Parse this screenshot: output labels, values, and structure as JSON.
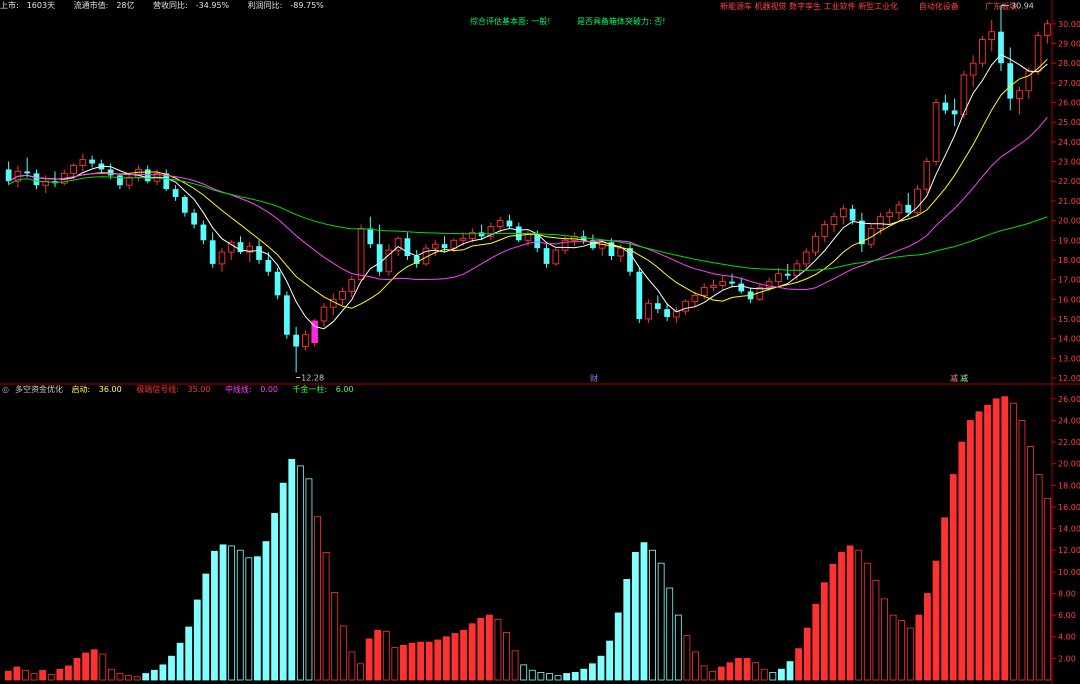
{
  "header": {
    "listing_days_label": "上市:",
    "listing_days": "1603天",
    "float_cap_label": "流通市值:",
    "float_cap": "28亿",
    "revenue_yoy_label": "营收同比:",
    "revenue_yoy": "-34.95%",
    "profit_yoy_label": "利润同比:",
    "profit_yoy": "-89.75%"
  },
  "signals": {
    "fundamental": "综合评估基本面: 一般!",
    "breakout": "是否具备箱体突破力: 否!"
  },
  "concept_tags": [
    "新能源车",
    "机器视觉",
    "数字孪生",
    "工业软件",
    "新型工业化",
    "自动化设备",
    "广东板块"
  ],
  "main_chart": {
    "y_ticks": [
      "30.00",
      "29.00",
      "28.00",
      "27.00",
      "26.00",
      "25.00",
      "24.00",
      "23.00",
      "22.00",
      "21.00",
      "20.00",
      "19.00",
      "18.00",
      "17.00",
      "16.00",
      "15.00",
      "14.00",
      "13.00",
      "12.00"
    ],
    "high_label": "30.94",
    "low_label": "12.28",
    "bottom_markers": [
      "财",
      "减",
      "减"
    ]
  },
  "sub_chart": {
    "indicator_name": "多空资金优化",
    "qidong_label": "启动:",
    "qidong_value": "36.00",
    "jiduan_label": "极端信号线:",
    "jiduan_value": "35.00",
    "zhongxian_label": "中线线:",
    "zhongxian_value": "0.00",
    "qianjin_label": "千金一柱:",
    "qianjin_value": "6.00",
    "y_ticks": [
      "26.00",
      "24.00",
      "22.00",
      "20.00",
      "18.00",
      "16.00",
      "14.00",
      "12.00",
      "10.00",
      "8.00",
      "6.00",
      "4.00",
      "2.00"
    ]
  },
  "colors": {
    "up": "#ff3232",
    "down": "#54fcfc",
    "ma5": "#ffffff",
    "ma10": "#ffff00",
    "ma20": "#ff40ff",
    "ma60": "#00dd00",
    "sell": "#ff4040",
    "buy": "#80ffff"
  },
  "chart_data": [
    {
      "type": "candlestick",
      "ylim": [
        12,
        30.5
      ],
      "y_ticks": [
        30,
        29,
        28,
        27,
        26,
        25,
        24,
        23,
        22,
        21,
        20,
        19,
        18,
        17,
        16,
        15,
        14,
        13,
        12
      ],
      "ohlc": [
        [
          22.6,
          23.0,
          21.8,
          22.0
        ],
        [
          22.0,
          22.8,
          21.7,
          22.5
        ],
        [
          22.5,
          23.2,
          22.2,
          22.4
        ],
        [
          22.4,
          22.6,
          21.6,
          21.8
        ],
        [
          21.8,
          22.3,
          21.4,
          22.0
        ],
        [
          22.0,
          22.5,
          21.7,
          21.9
        ],
        [
          21.9,
          22.6,
          21.8,
          22.4
        ],
        [
          22.4,
          22.9,
          22.1,
          22.8
        ],
        [
          22.8,
          23.4,
          22.5,
          23.1
        ],
        [
          23.1,
          23.3,
          22.7,
          22.9
        ],
        [
          22.9,
          23.1,
          22.4,
          22.6
        ],
        [
          22.6,
          22.9,
          22.1,
          22.3
        ],
        [
          22.3,
          22.4,
          21.6,
          21.8
        ],
        [
          21.8,
          22.4,
          21.6,
          22.2
        ],
        [
          22.2,
          22.8,
          22.0,
          22.6
        ],
        [
          22.6,
          22.8,
          21.9,
          22.0
        ],
        [
          22.0,
          22.6,
          21.8,
          22.4
        ],
        [
          22.4,
          22.6,
          21.5,
          21.6
        ],
        [
          21.6,
          21.8,
          21.0,
          21.2
        ],
        [
          21.2,
          21.3,
          20.2,
          20.4
        ],
        [
          20.4,
          20.6,
          19.6,
          19.8
        ],
        [
          19.8,
          20.0,
          18.8,
          19.0
        ],
        [
          19.0,
          19.4,
          17.6,
          17.8
        ],
        [
          17.8,
          18.6,
          17.4,
          18.4
        ],
        [
          18.4,
          19.0,
          18.0,
          18.9
        ],
        [
          18.9,
          19.2,
          18.3,
          18.4
        ],
        [
          18.4,
          18.9,
          17.9,
          18.7
        ],
        [
          18.7,
          19.0,
          17.8,
          18.0
        ],
        [
          18.0,
          18.4,
          17.2,
          17.4
        ],
        [
          17.4,
          17.6,
          16.0,
          16.2
        ],
        [
          16.2,
          16.4,
          14.0,
          14.2
        ],
        [
          14.2,
          14.6,
          12.28,
          13.6
        ],
        [
          13.6,
          14.4,
          13.4,
          14.2
        ],
        [
          13.8,
          15.0,
          13.6,
          14.9
        ],
        [
          14.9,
          15.8,
          14.6,
          15.6
        ],
        [
          15.6,
          16.3,
          15.2,
          16.0
        ],
        [
          16.0,
          16.6,
          15.7,
          16.4
        ],
        [
          16.4,
          17.2,
          16.1,
          17.0
        ],
        [
          17.0,
          19.8,
          16.9,
          19.6
        ],
        [
          19.6,
          20.2,
          18.6,
          18.8
        ],
        [
          18.8,
          19.8,
          17.2,
          17.4
        ],
        [
          17.4,
          18.8,
          17.2,
          18.5
        ],
        [
          18.5,
          19.2,
          18.2,
          19.1
        ],
        [
          19.1,
          19.4,
          18.0,
          18.2
        ],
        [
          18.2,
          18.5,
          17.6,
          17.8
        ],
        [
          17.8,
          18.8,
          17.7,
          18.6
        ],
        [
          18.6,
          19.0,
          18.2,
          18.8
        ],
        [
          18.8,
          19.2,
          18.4,
          18.6
        ],
        [
          18.6,
          19.1,
          18.4,
          19.0
        ],
        [
          19.0,
          19.4,
          18.7,
          19.1
        ],
        [
          19.1,
          19.6,
          18.9,
          19.4
        ],
        [
          19.4,
          19.8,
          19.0,
          19.2
        ],
        [
          19.2,
          19.9,
          19.0,
          19.7
        ],
        [
          19.7,
          20.2,
          19.4,
          20.0
        ],
        [
          20.0,
          20.3,
          19.6,
          19.7
        ],
        [
          19.7,
          19.9,
          18.9,
          19.0
        ],
        [
          19.0,
          19.5,
          18.7,
          19.3
        ],
        [
          19.3,
          19.5,
          18.4,
          18.6
        ],
        [
          18.6,
          18.8,
          17.6,
          17.8
        ],
        [
          17.8,
          18.6,
          17.7,
          18.5
        ],
        [
          18.5,
          19.2,
          18.3,
          19.0
        ],
        [
          19.0,
          19.4,
          18.7,
          19.2
        ],
        [
          19.2,
          19.5,
          18.8,
          19.0
        ],
        [
          19.0,
          19.3,
          18.5,
          18.6
        ],
        [
          18.6,
          19.0,
          18.2,
          18.9
        ],
        [
          18.9,
          19.1,
          18.0,
          18.2
        ],
        [
          18.2,
          18.8,
          17.9,
          18.6
        ],
        [
          18.6,
          18.9,
          17.2,
          17.4
        ],
        [
          17.4,
          17.6,
          14.8,
          15.0
        ],
        [
          15.0,
          16.0,
          14.8,
          15.8
        ],
        [
          15.8,
          16.2,
          15.3,
          15.5
        ],
        [
          15.5,
          15.8,
          14.9,
          15.1
        ],
        [
          15.1,
          15.6,
          14.8,
          15.4
        ],
        [
          15.4,
          16.0,
          15.2,
          15.9
        ],
        [
          15.9,
          16.4,
          15.6,
          16.2
        ],
        [
          16.2,
          16.8,
          16.0,
          16.6
        ],
        [
          16.6,
          17.0,
          16.4,
          16.7
        ],
        [
          16.7,
          17.2,
          16.5,
          16.9
        ],
        [
          16.9,
          17.3,
          16.6,
          16.8
        ],
        [
          16.8,
          17.1,
          16.3,
          16.4
        ],
        [
          16.4,
          16.6,
          15.8,
          16.0
        ],
        [
          16.0,
          16.8,
          15.9,
          16.6
        ],
        [
          16.6,
          17.1,
          16.4,
          16.9
        ],
        [
          16.9,
          17.6,
          16.7,
          17.3
        ],
        [
          17.3,
          17.8,
          17.0,
          17.2
        ],
        [
          17.2,
          18.0,
          17.0,
          17.8
        ],
        [
          17.8,
          18.6,
          17.6,
          18.4
        ],
        [
          18.4,
          19.4,
          18.2,
          19.2
        ],
        [
          19.2,
          20.0,
          18.9,
          19.8
        ],
        [
          19.8,
          20.4,
          19.4,
          20.2
        ],
        [
          20.2,
          20.8,
          19.8,
          20.6
        ],
        [
          20.6,
          20.8,
          19.8,
          20.0
        ],
        [
          20.0,
          20.4,
          18.4,
          18.8
        ],
        [
          18.8,
          19.8,
          18.6,
          19.6
        ],
        [
          19.6,
          20.4,
          19.3,
          20.2
        ],
        [
          20.2,
          20.6,
          19.8,
          20.4
        ],
        [
          20.4,
          21.0,
          20.0,
          20.8
        ],
        [
          20.8,
          21.4,
          20.2,
          20.4
        ],
        [
          20.4,
          21.8,
          20.2,
          21.6
        ],
        [
          21.6,
          23.2,
          21.4,
          23.0
        ],
        [
          23.0,
          26.2,
          22.8,
          26.0
        ],
        [
          26.0,
          26.4,
          25.4,
          25.6
        ],
        [
          25.6,
          26.2,
          24.8,
          25.4
        ],
        [
          25.4,
          27.6,
          25.2,
          27.4
        ],
        [
          27.4,
          28.4,
          26.8,
          28.0
        ],
        [
          28.0,
          29.4,
          27.8,
          29.2
        ],
        [
          29.2,
          30.2,
          28.6,
          29.6
        ],
        [
          29.6,
          30.94,
          27.6,
          28.0
        ],
        [
          28.0,
          28.8,
          25.6,
          26.2
        ],
        [
          26.2,
          26.8,
          25.4,
          26.6
        ],
        [
          26.6,
          27.8,
          26.2,
          27.6
        ],
        [
          27.6,
          29.6,
          27.4,
          29.4
        ],
        [
          29.4,
          30.2,
          29.0,
          30.0
        ]
      ]
    },
    {
      "type": "bar",
      "ylim": [
        0,
        27
      ],
      "y_ticks": [
        26,
        24,
        22,
        20,
        18,
        16,
        14,
        12,
        10,
        8,
        6,
        4,
        2
      ],
      "values": [
        0.8,
        1.2,
        0.9,
        0.6,
        0.9,
        0.5,
        1.0,
        1.3,
        2.0,
        2.5,
        2.8,
        2.4,
        1.0,
        0.6,
        0.4,
        0.3,
        0.6,
        0.9,
        1.4,
        2.2,
        3.4,
        4.9,
        7.4,
        9.8,
        11.9,
        12.5,
        12.4,
        12.0,
        11.3,
        11.4,
        12.8,
        15.4,
        18.2,
        20.4,
        19.8,
        18.6,
        15.1,
        11.8,
        8.1,
        5.0,
        2.6,
        1.5,
        3.8,
        4.6,
        4.5,
        3.0,
        3.2,
        3.4,
        3.5,
        3.5,
        3.7,
        4.0,
        4.3,
        4.6,
        5.2,
        5.7,
        6.0,
        5.6,
        4.4,
        2.7,
        1.4,
        0.9,
        0.7,
        0.6,
        0.4,
        0.6,
        0.7,
        1.0,
        1.5,
        2.2,
        3.6,
        6.2,
        9.3,
        11.8,
        12.7,
        12.0,
        10.8,
        8.5,
        6.0,
        4.1,
        2.6,
        1.3,
        0.8,
        1.2,
        1.6,
        2.0,
        2.0,
        1.6,
        1.0,
        0.7,
        1.0,
        1.7,
        2.9,
        4.8,
        7.0,
        9.0,
        10.7,
        11.8,
        12.4,
        12.0,
        10.8,
        9.2,
        7.5,
        6.0,
        5.5,
        4.8,
        6.0,
        8.0,
        11.0,
        15.0,
        19.0,
        22.0,
        24.0,
        24.8,
        25.4,
        26.0,
        26.2,
        25.6,
        24.0,
        21.6,
        19.0,
        16.8
      ],
      "colors_by_index": "red=up-trend segments, cyan=down-trend segments"
    }
  ]
}
